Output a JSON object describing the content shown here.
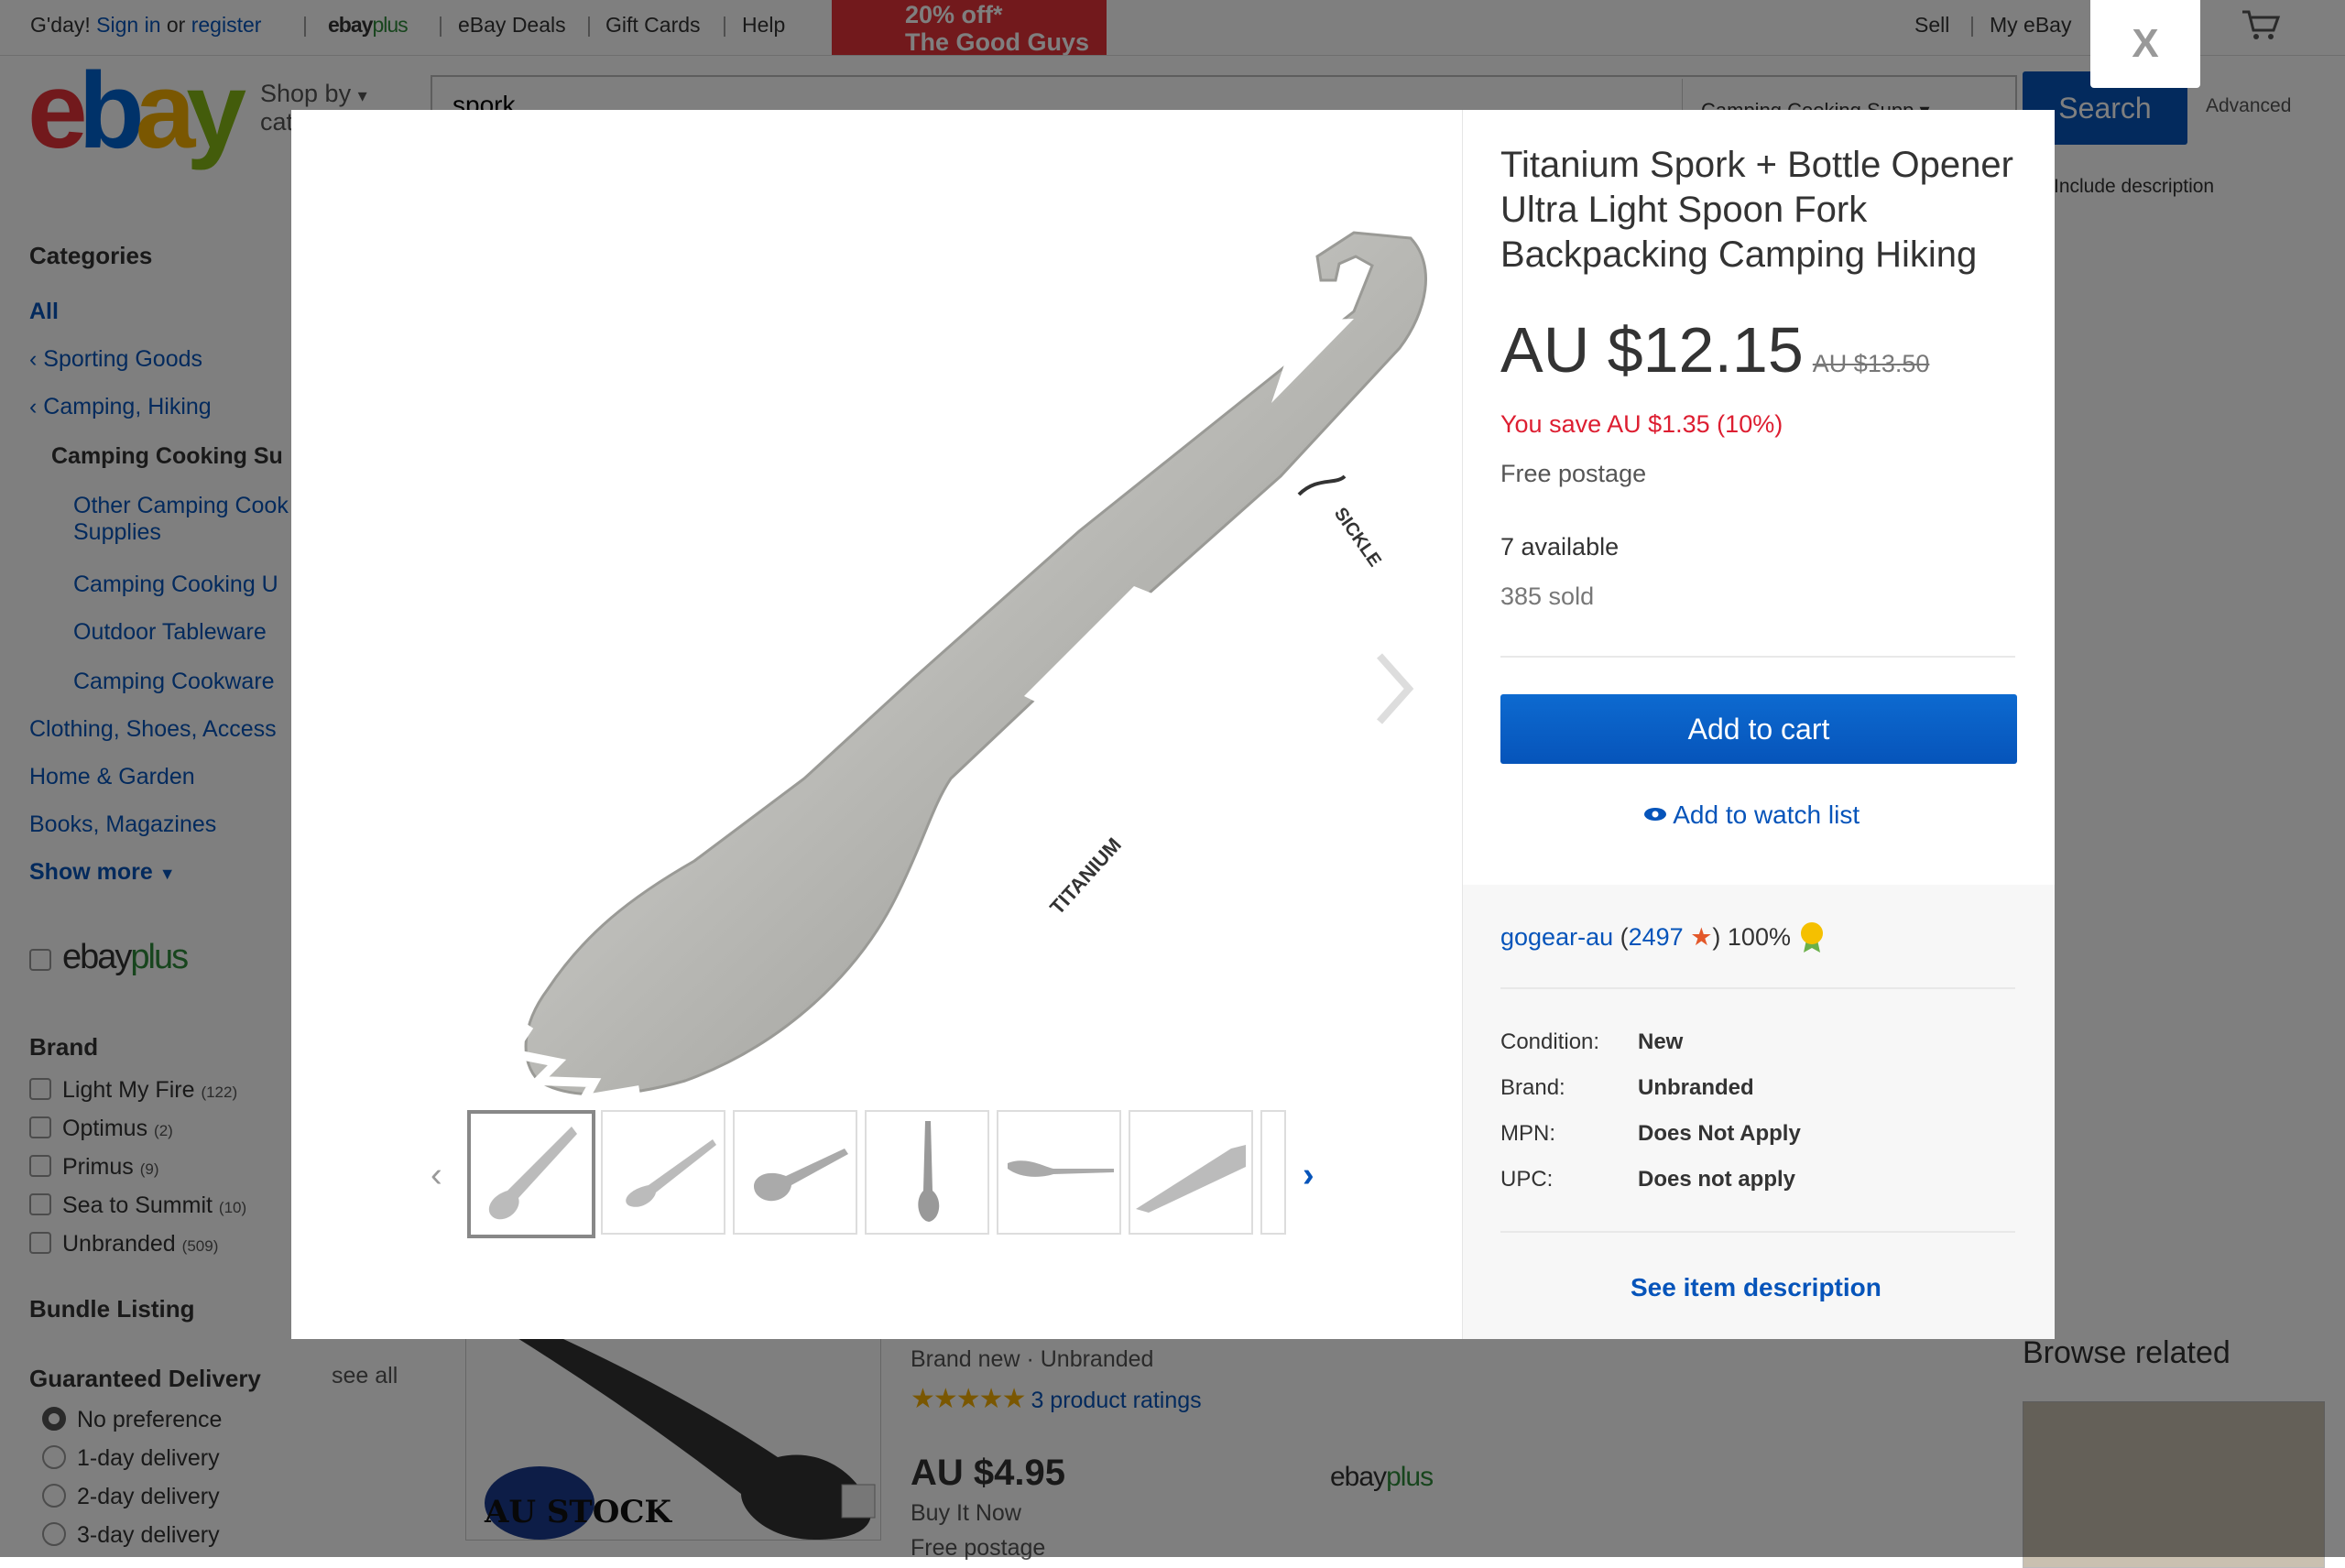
{
  "topbar": {
    "greeting": "G'day!",
    "sign_in": "Sign in",
    "or": "or",
    "register": "register",
    "ebayplus_a": "ebay",
    "ebayplus_b": "plus",
    "deals": "eBay Deals",
    "gift_cards": "Gift Cards",
    "help": "Help",
    "promo_line1": "20% off*",
    "promo_line2": "The Good Guys",
    "sell": "Sell",
    "my_ebay": "My eBay"
  },
  "header": {
    "shop_by": "Shop by",
    "shop_by_2": "category",
    "search_value": "spork",
    "category_select": "Camping Cooking Supp",
    "search_button": "Search",
    "advanced": "Advanced",
    "include_description": "Include description"
  },
  "sidebar": {
    "categories_heading": "Categories",
    "all": "All",
    "sporting_goods": "Sporting Goods",
    "camping_hiking": "Camping, Hiking",
    "camping_cooking_supplies": "Camping Cooking Su",
    "sub_items": [
      "Other Camping Cook",
      "Supplies",
      "Camping Cooking U",
      "Outdoor Tableware",
      "Camping Cookware"
    ],
    "clothing": "Clothing, Shoes, Access",
    "home_garden": "Home & Garden",
    "books": "Books, Magazines",
    "show_more": "Show more",
    "ebayplus_a": "ebay",
    "ebayplus_b": "plus",
    "brand_heading": "Brand",
    "brands": [
      {
        "name": "Light My Fire",
        "count": "(122)"
      },
      {
        "name": "Optimus",
        "count": "(2)"
      },
      {
        "name": "Primus",
        "count": "(9)"
      },
      {
        "name": "Sea to Summit",
        "count": "(10)"
      },
      {
        "name": "Unbranded",
        "count": "(509)"
      }
    ],
    "bundle_heading": "Bundle Listing",
    "delivery_heading": "Guaranteed Delivery",
    "see_all": "see all",
    "delivery_options": [
      "No preference",
      "1-day delivery",
      "2-day delivery",
      "3-day delivery"
    ]
  },
  "listing": {
    "au_stock": "AU STOCK",
    "condition_brand": "Brand new · Unbranded",
    "ratings": "3 product ratings",
    "price": "AU $4.95",
    "buy_type": "Buy It Now",
    "postage": "Free postage",
    "ebayplus_a": "ebay",
    "ebayplus_b": "plus",
    "browse_related": "Browse related"
  },
  "modal": {
    "close": "X",
    "title": "Titanium Spork + Bottle Opener Ultra Light Spoon Fork Backpacking Camping Hiking",
    "price": "AU $12.15",
    "was_price": "AU $13.50",
    "you_save": "You save AU $1.35 (10%)",
    "postage": "Free postage",
    "available": "7 available",
    "sold": "385 sold",
    "add_to_cart": "Add to cart",
    "add_to_watch": "Add to watch list",
    "seller_name": "gogear-au",
    "seller_feedback": "2497",
    "seller_pct": ") 100%",
    "specs": [
      {
        "label": "Condition:",
        "value": "New"
      },
      {
        "label": "Brand:",
        "value": "Unbranded"
      },
      {
        "label": "MPN:",
        "value": "Does Not Apply"
      },
      {
        "label": "UPC:",
        "value": "Does not apply"
      }
    ],
    "see_description": "See item description",
    "engraving_1": "SICKLE",
    "engraving_2": "TITANIUM"
  },
  "colors": {
    "link": "#0654ba",
    "cart_button": "#0654ba",
    "save_red": "#dd1e31"
  }
}
